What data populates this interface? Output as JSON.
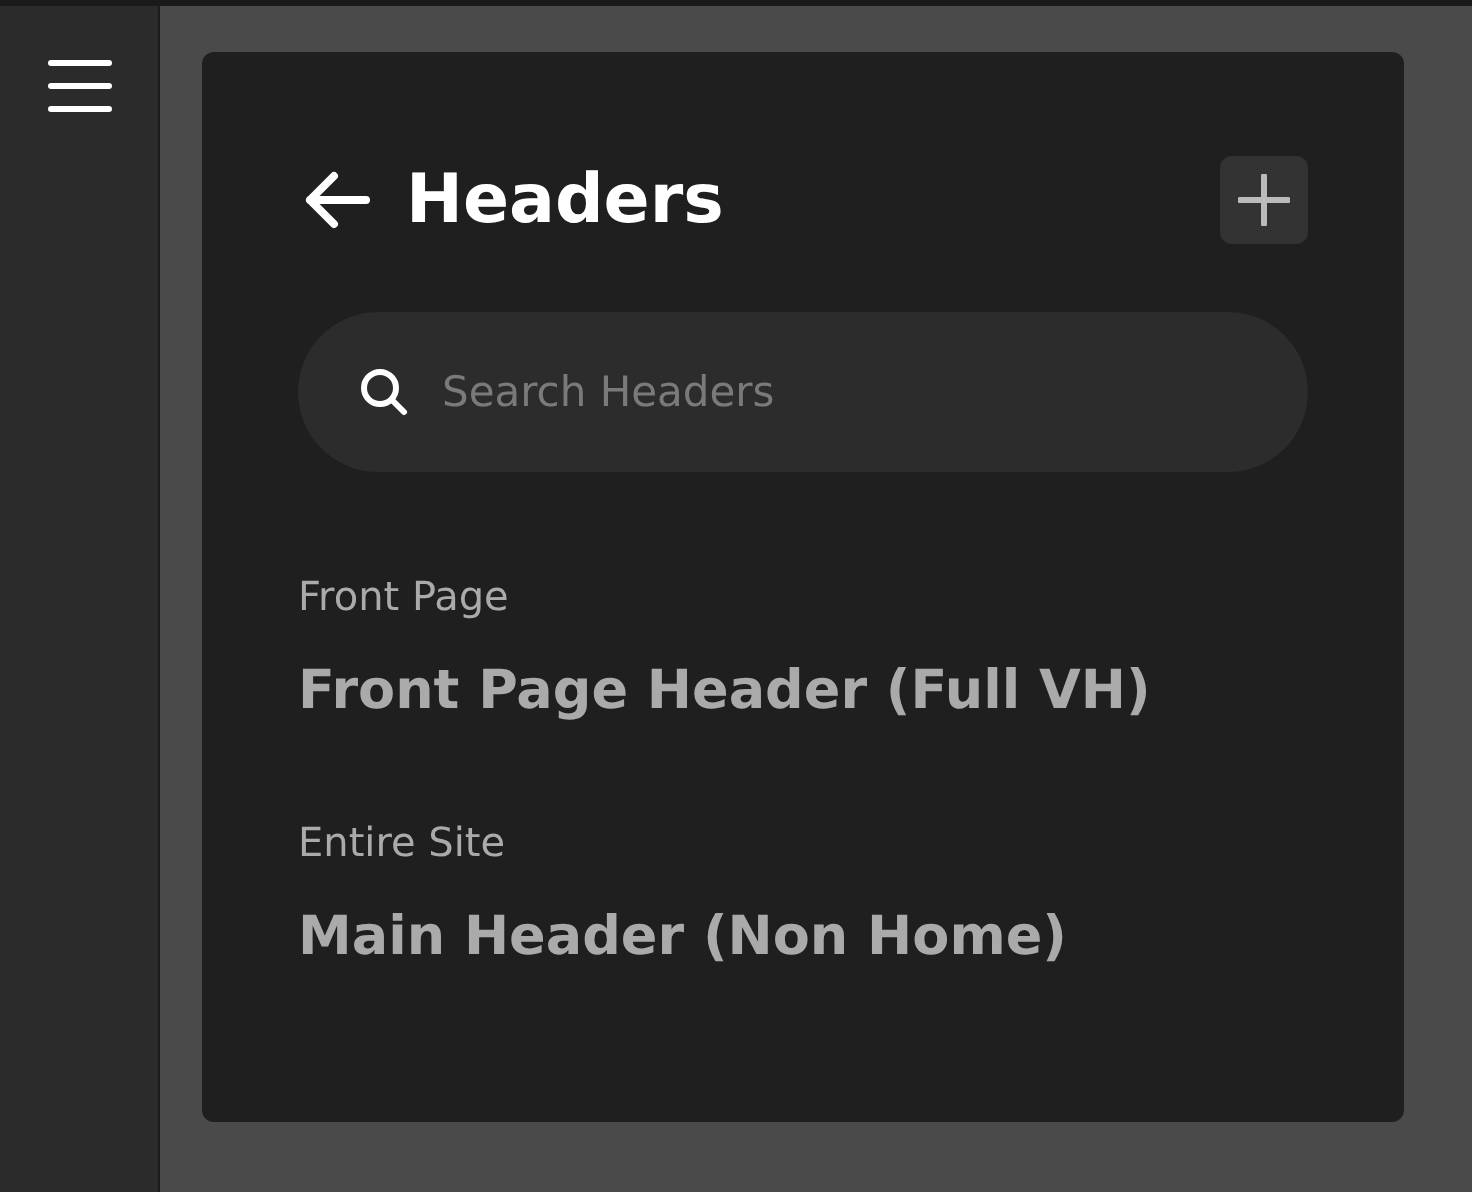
{
  "panel": {
    "title": "Headers",
    "search": {
      "placeholder": "Search Headers"
    },
    "groups": [
      {
        "label": "Front Page",
        "items": [
          {
            "name": "Front Page Header (Full VH)"
          }
        ]
      },
      {
        "label": "Entire Site",
        "items": [
          {
            "name": "Main Header (Non Home)"
          }
        ]
      }
    ]
  }
}
